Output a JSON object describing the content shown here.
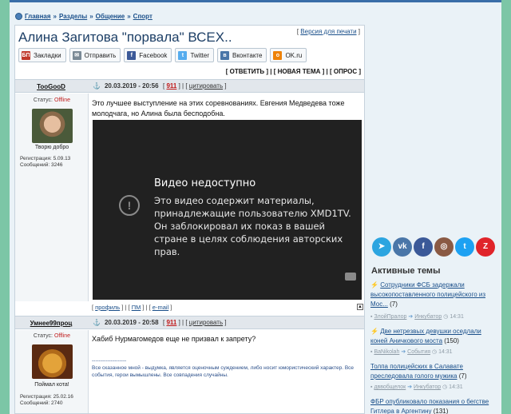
{
  "breadcrumbs": {
    "items": [
      "Главная",
      "Разделы",
      "Общение",
      "Спорт"
    ],
    "sep": "»"
  },
  "thread": {
    "title": "Алина Загитова \"порвала\" ВСЕХ..",
    "print_version": "Версия для печати",
    "share": [
      {
        "label": "Закладки",
        "icon": "bookmarks-icon",
        "color": "#c0392b",
        "glyph": "БП"
      },
      {
        "label": "Отправить",
        "icon": "mail-icon",
        "color": "#7a8a96",
        "glyph": "✉"
      },
      {
        "label": "Facebook",
        "icon": "facebook-icon",
        "color": "#3b5998",
        "glyph": "f"
      },
      {
        "label": "Twitter",
        "icon": "twitter-icon",
        "color": "#55acee",
        "glyph": "t"
      },
      {
        "label": "Вконтакте",
        "icon": "vk-icon",
        "color": "#4a76a8",
        "glyph": "в"
      },
      {
        "label": "OK.ru",
        "icon": "odnoklassniki-icon",
        "color": "#ee8208",
        "glyph": "о"
      }
    ],
    "actions": [
      "ОТВЕТИТЬ",
      "НОВАЯ ТЕМА",
      "ОПРОС"
    ]
  },
  "posts": [
    {
      "user": "TooGooD",
      "date": "20.03.2019 - 20:56",
      "num": "911",
      "quote": "цитировать",
      "status_label": "Статус:",
      "status": "Offline",
      "user_title": "Творю добро",
      "reg": "Регистрация: 5.09.13",
      "msgs": "Сообщений: 3246",
      "text": "Это лучшее выступление на этих соревнованиях. Евгения Медведева тоже молодчага, но Алина была бесподобна.",
      "links": [
        "профиль",
        "ПМ",
        "e-mail"
      ]
    },
    {
      "user": "Умнее99проц",
      "date": "20.03.2019 - 20:58",
      "num": "911",
      "quote": "цитировать",
      "status_label": "Статус:",
      "status": "Offline",
      "user_title": "Поймал кота!",
      "reg": "Регистрация: 25.02.16",
      "msgs": "Сообщений: 2740",
      "text": "Хабиб Нурмагомедов еще не призвал к запрету?",
      "sig_line": "--------------------",
      "sig": "Все сказанное мной - выдумка, является оценочным суждением, либо носит юмористический характер. Все события, герои вымышлены. Все совпадения случайны."
    }
  ],
  "video": {
    "title": "Видео недоступно",
    "message": "Это видео содержит материалы, принадлежащие пользователю XMD1TV. Он заблокировал их показ в вашей стране в целях соблюдения авторских прав.",
    "warn_glyph": "!"
  },
  "sidebar": {
    "socials": [
      {
        "icon": "telegram-icon",
        "color": "#2ca5e0",
        "glyph": "➤"
      },
      {
        "icon": "vk-icon",
        "color": "#4a76a8",
        "glyph": "vk"
      },
      {
        "icon": "facebook-icon",
        "color": "#3b5998",
        "glyph": "f"
      },
      {
        "icon": "instagram-icon",
        "color": "#8a5a44",
        "glyph": "◎"
      },
      {
        "icon": "twitter-icon",
        "color": "#1da1f2",
        "glyph": "t"
      },
      {
        "icon": "zen-icon",
        "color": "#e0242a",
        "glyph": "Z"
      }
    ],
    "active_title": "Активные темы",
    "topics": [
      {
        "fire": true,
        "title": "Сотрудники ФСБ задержали высокопоставленного полицейского из Мос...",
        "count": "(7)",
        "from": "ЗлойПралор",
        "to": "Инкубатор",
        "time": "14:31"
      },
      {
        "fire": true,
        "title": "Две нетрезвых девушки оседлали коней Аничкового моста",
        "count": "(150)",
        "from": "BaNikolah",
        "to": "События",
        "time": "14:31"
      },
      {
        "fire": false,
        "title": "Толпа полицейских в Салавате преследовала голого мужика",
        "count": "(7)",
        "from": "дввобщелок",
        "to": "Инкубатор",
        "time": "14:31"
      },
      {
        "fire": false,
        "title": "ФБР опубликовало показания о бегстве Гитлера в Аргентину",
        "count": "(131)",
        "from": "",
        "to": "",
        "time": ""
      }
    ]
  }
}
